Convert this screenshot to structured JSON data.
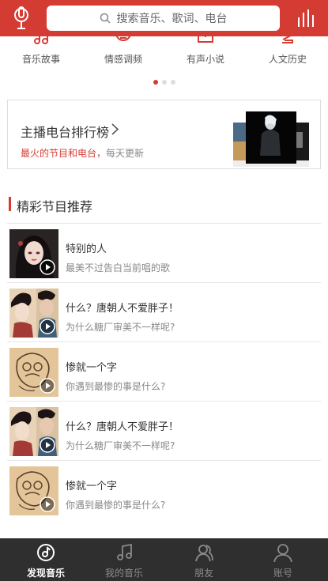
{
  "header": {
    "search_placeholder": "搜索音乐、歌词、电台",
    "mic_icon": "mic-icon",
    "equalizer_icon": "equalizer-icon"
  },
  "categories": [
    {
      "label": "音乐故事",
      "icon": "music-story-icon"
    },
    {
      "label": "情感调频",
      "icon": "emotion-fm-icon"
    },
    {
      "label": "有声小说",
      "icon": "audiobook-icon"
    },
    {
      "label": "人文历史",
      "icon": "history-icon"
    }
  ],
  "carousel": {
    "pages": 3,
    "active": 1
  },
  "rank_card": {
    "title": "主播电台排行榜",
    "subtitle_highlight": "最火的节目和电台，",
    "subtitle_rest": "每天更新"
  },
  "section": {
    "title": "精彩节目推荐"
  },
  "programs": [
    {
      "title": "特别的人",
      "desc": "最美不过告白当前唱的歌",
      "thumb": "portrait-girl"
    },
    {
      "title": "什么？唐朝人不爱胖子！",
      "desc": "为什么糖厂审美不一样呢?",
      "thumb": "tang-lady"
    },
    {
      "title": "惨就一个字",
      "desc": "你遇到最惨的事是什么?",
      "thumb": "sketch-face"
    },
    {
      "title": "什么？唐朝人不爱胖子！",
      "desc": "为什么糖厂审美不一样呢?",
      "thumb": "tang-lady"
    },
    {
      "title": "惨就一个字",
      "desc": "你遇到最惨的事是什么?",
      "thumb": "sketch-face"
    }
  ],
  "tabbar": [
    {
      "label": "发现音乐",
      "icon": "discover-music-icon",
      "active": true
    },
    {
      "label": "我的音乐",
      "icon": "my-music-icon",
      "active": false
    },
    {
      "label": "朋友",
      "icon": "friends-icon",
      "active": false
    },
    {
      "label": "账号",
      "icon": "account-icon",
      "active": false
    }
  ],
  "colors": {
    "brand": "#d43c33",
    "tabbar_bg": "#2f2f2f"
  }
}
